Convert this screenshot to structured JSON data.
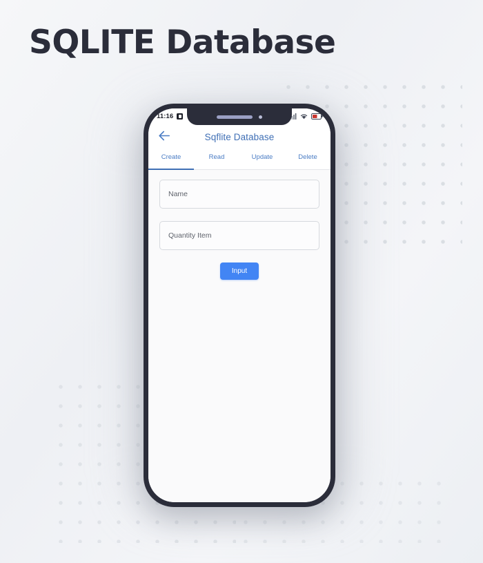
{
  "poster": {
    "title": "SQLITE Database",
    "background_color": "#eef0f4",
    "title_color": "#2b2d3a",
    "dot_color": "#d9dde2"
  },
  "phone": {
    "frame_color": "#2b2d3a",
    "screen_background": "#fafafb"
  },
  "status_bar": {
    "time": "11:16",
    "app_icon": "screenshot-icon",
    "signal_icon": "cellular-signal-icon",
    "wifi_icon": "wifi-icon",
    "battery_icon": "battery-low-icon",
    "battery_color": "#c8352f"
  },
  "app_bar": {
    "back_icon": "back-arrow-icon",
    "title": "Sqflite Database",
    "title_color": "#3f6fb5"
  },
  "tabs": {
    "active_index": 0,
    "indicator_color": "#3f6fb5",
    "items": [
      {
        "label": "Create"
      },
      {
        "label": "Read"
      },
      {
        "label": "Update"
      },
      {
        "label": "Delete"
      }
    ]
  },
  "form": {
    "fields": [
      {
        "name": "name",
        "placeholder": "Name",
        "value": ""
      },
      {
        "name": "quantity",
        "placeholder": "Quantity Item",
        "value": ""
      }
    ],
    "submit_label": "Input",
    "submit_color": "#4285f4"
  }
}
